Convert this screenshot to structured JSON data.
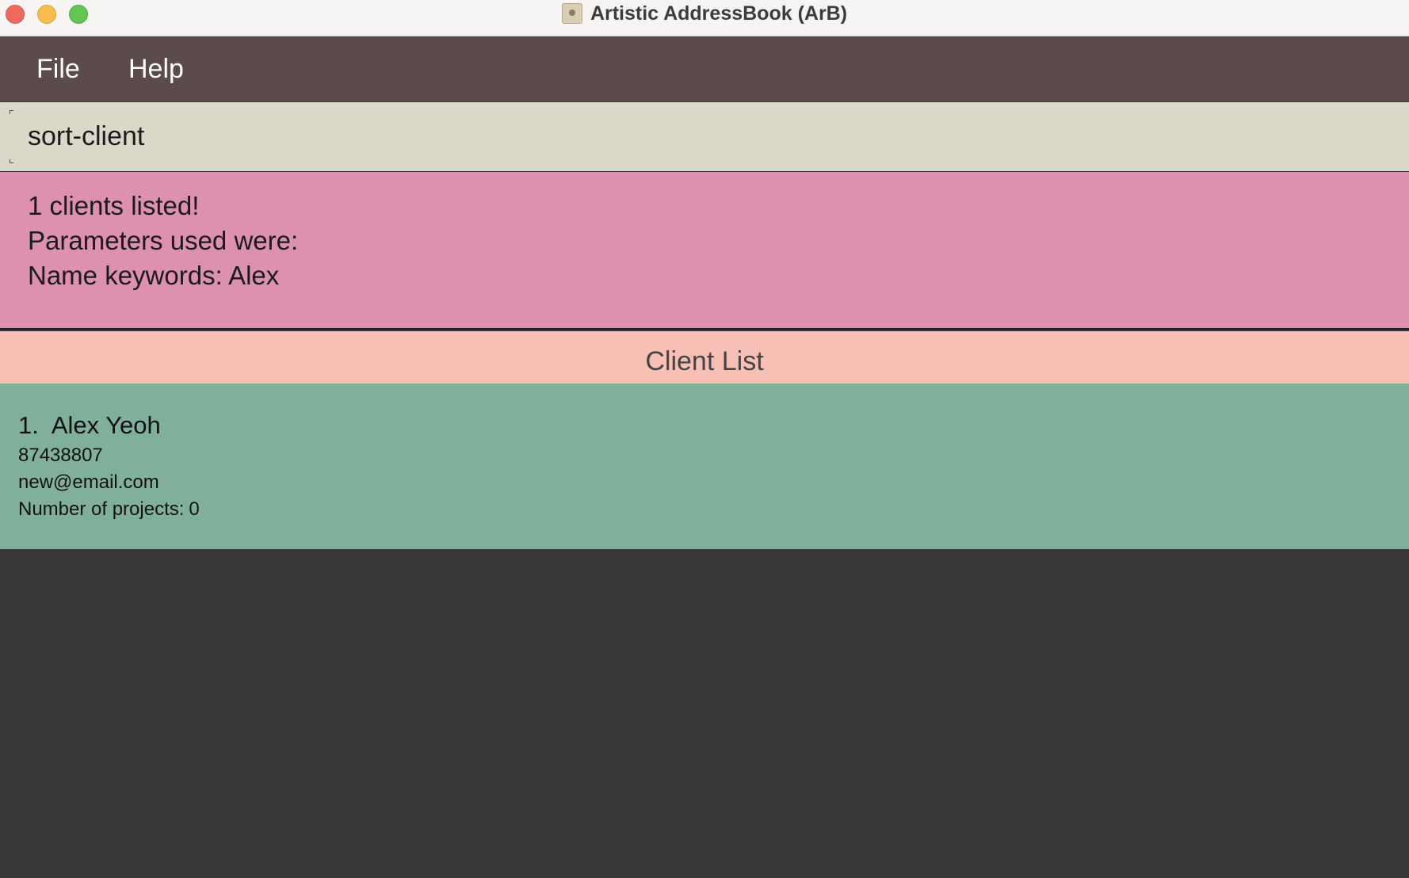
{
  "window": {
    "title": "Artistic AddressBook (ArB)",
    "icon": "address-book-icon"
  },
  "menubar": {
    "items": [
      {
        "label": "File"
      },
      {
        "label": "Help"
      }
    ]
  },
  "command_box": {
    "value": "sort-client"
  },
  "result_display": {
    "lines": [
      "1 clients listed!",
      "Parameters used were:",
      "Name keywords: Alex"
    ]
  },
  "client_list": {
    "header": "Client List",
    "clients": [
      {
        "index": "1.",
        "name": "Alex Yeoh",
        "phone": "87438807",
        "email": "new@email.com",
        "projects_label": "Number of projects:",
        "projects_count": "0"
      }
    ]
  },
  "colors": {
    "menubar": "#5b4b4a",
    "command_box": "#dbd8c9",
    "result_display": "#dd90af",
    "list_header": "#f8bfb4",
    "client_card": "#80af9c",
    "background": "#383838"
  }
}
